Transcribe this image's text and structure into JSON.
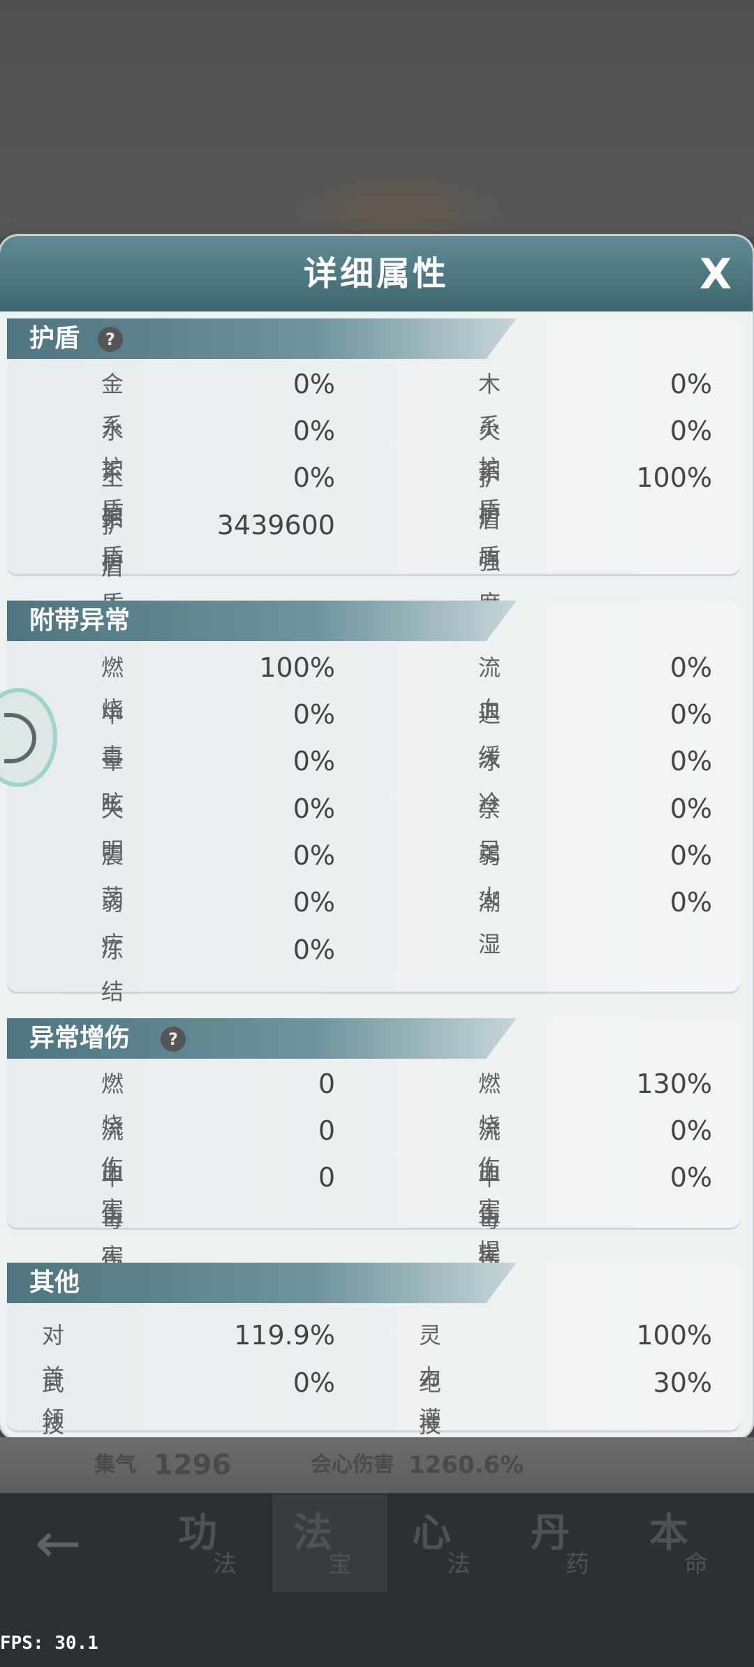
{
  "dialog": {
    "title": "详细属性",
    "close_label": "X"
  },
  "sections": {
    "shield": {
      "title": "护盾",
      "rows": [
        {
          "l1": "金系护盾",
          "v1": "0%",
          "l2": "木系护盾",
          "v2": "0%"
        },
        {
          "l1": "水系护盾",
          "v1": "0%",
          "l2": "火系护盾",
          "v2": "0%"
        },
        {
          "l1": "土系护盾",
          "v1": "0%",
          "l2": "护盾强度",
          "v2": "100%"
        },
        {
          "l1": "护盾上限",
          "v1": "3439600"
        }
      ]
    },
    "status": {
      "title": "附带异常",
      "rows": [
        {
          "l1": "燃烧",
          "v1": "100%",
          "l2": "流血",
          "v2": "0%"
        },
        {
          "l1": "中毒",
          "v1": "0%",
          "l2": "迟缓",
          "v2": "0%"
        },
        {
          "l1": "晕眩",
          "v1": "0%",
          "l2": "冰冷",
          "v2": "0%"
        },
        {
          "l1": "失明",
          "v1": "0%",
          "l2": "禁足",
          "v2": "0%"
        },
        {
          "l1": "震荡",
          "v1": "0%",
          "l2": "弱火",
          "v2": "0%"
        },
        {
          "l1": "弱疗",
          "v1": "0%",
          "l2": "潮湿",
          "v2": "0%"
        },
        {
          "l1": "冻结",
          "v1": "0%"
        }
      ]
    },
    "status_damage": {
      "title": "异常增伤",
      "rows": [
        {
          "l1": "燃烧伤害",
          "v1": "0",
          "l2": "燃烧伤害提高",
          "v2": "130%"
        },
        {
          "l1": "流血伤害",
          "v1": "0",
          "l2": "流血伤害提高",
          "v2": "0%"
        },
        {
          "l1": "中毒伤害",
          "v1": "0",
          "l2": "中毒伤害提高",
          "v2": "0%"
        }
      ]
    },
    "other": {
      "title": "其他",
      "rows": [
        {
          "l1": "对首领伤害提高",
          "v1": "119.9%",
          "l2": "灵力灌注效果",
          "v2": "100%"
        },
        {
          "l1": "武技加速施展",
          "v1": "0%",
          "l2": "绝技施法间隔缩短",
          "v2": "30%"
        }
      ]
    }
  },
  "underlay": {
    "stat1_label": "集气",
    "stat1_value": "1296",
    "stat2_label": "会心伤害",
    "stat2_value": "1260.6%"
  },
  "tabs": [
    {
      "big": "功",
      "small": "法"
    },
    {
      "big": "法",
      "small": "宝"
    },
    {
      "big": "心",
      "small": "法"
    },
    {
      "big": "丹",
      "small": "药"
    },
    {
      "big": "本",
      "small": "命"
    }
  ],
  "fps": "FPS: 30.1",
  "help_icon": "?"
}
